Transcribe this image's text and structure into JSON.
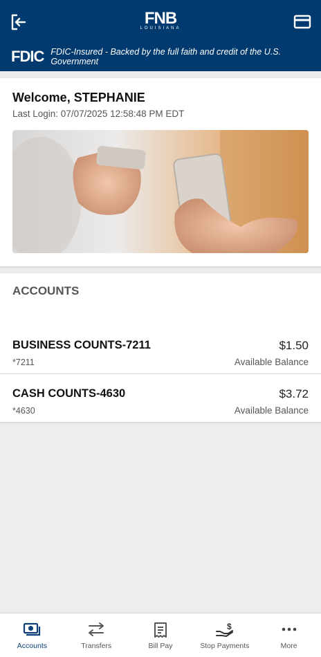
{
  "header": {
    "logo_main": "FNB",
    "logo_sub": "LOUISIANA",
    "fdic_badge": "FDIC",
    "fdic_text": "FDIC-Insured - Backed by the full faith and credit of the U.S. Government",
    "icons": [
      "logout-icon",
      "card-icon"
    ]
  },
  "welcome": {
    "title": "Welcome, STEPHANIE",
    "last_login": "Last Login: 07/07/2025 12:58:48 PM EDT"
  },
  "accounts": {
    "heading": "ACCOUNTS",
    "items": [
      {
        "name": "BUSINESS COUNTS-7211",
        "number": "*7211",
        "balance": "$1.50",
        "balance_label": "Available Balance"
      },
      {
        "name": "CASH COUNTS-4630",
        "number": "*4630",
        "balance": "$3.72",
        "balance_label": "Available Balance"
      }
    ]
  },
  "nav": {
    "items": [
      {
        "label": "Accounts",
        "icon": "accounts-icon",
        "active": true
      },
      {
        "label": "Transfers",
        "icon": "transfers-icon",
        "active": false
      },
      {
        "label": "Bill Pay",
        "icon": "bill-pay-icon",
        "active": false
      },
      {
        "label": "Stop Payments",
        "icon": "stop-payments-icon",
        "active": false
      },
      {
        "label": "More",
        "icon": "more-icon",
        "active": false
      }
    ]
  },
  "colors": {
    "brand": "#003a6e",
    "active_nav": "#0b3f75"
  }
}
